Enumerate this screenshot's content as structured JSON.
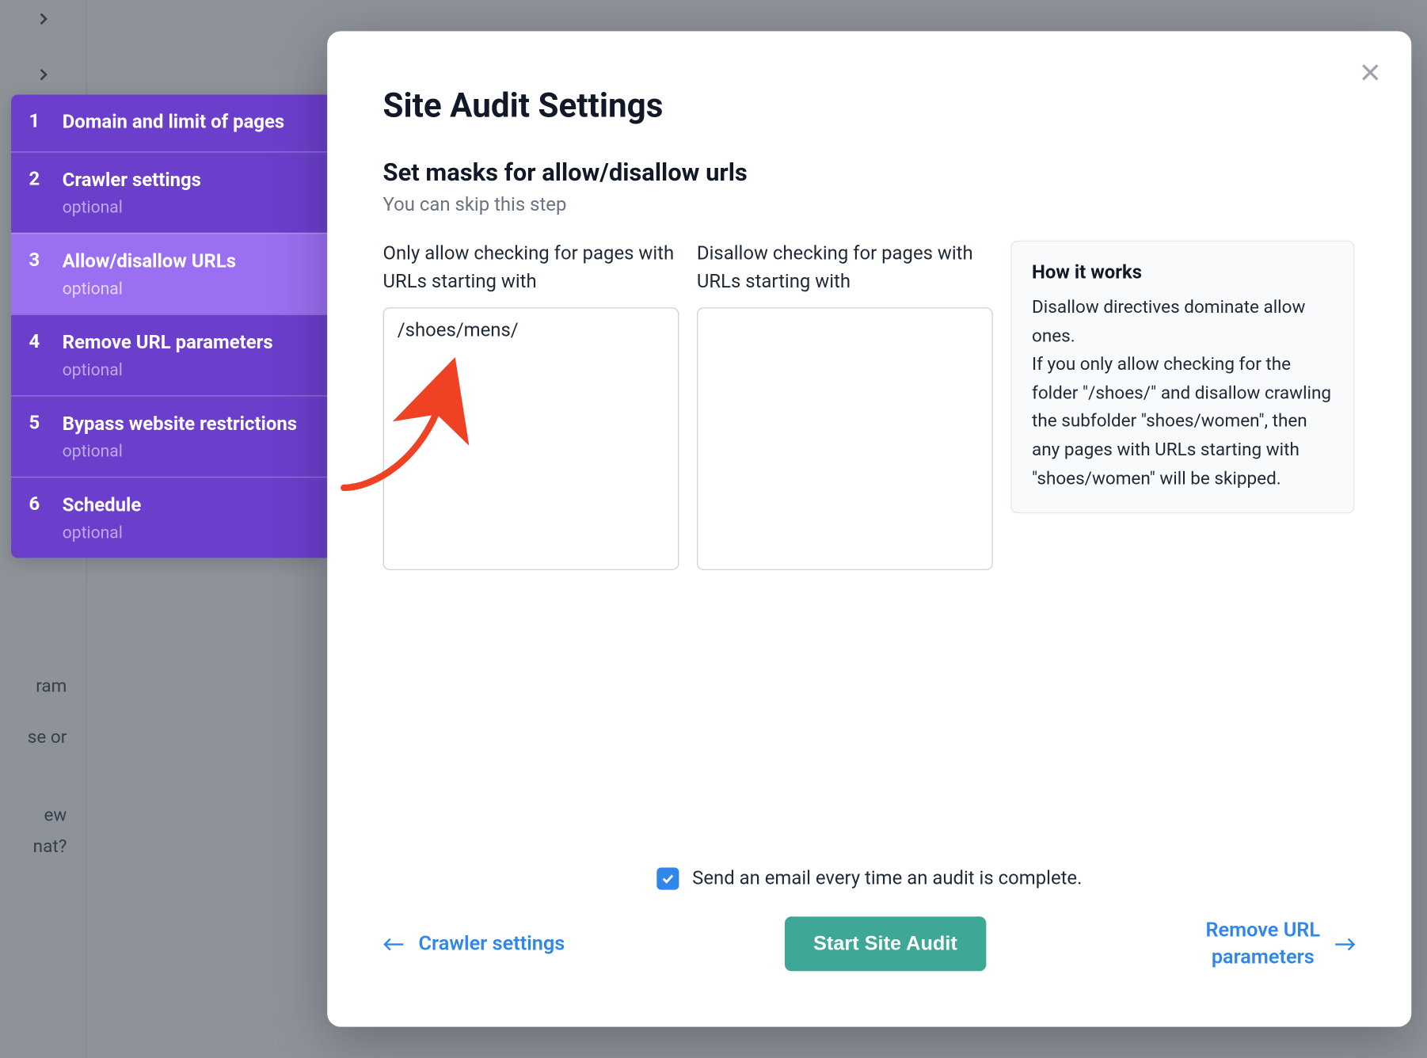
{
  "bg_fragments": [
    "ram",
    "se or",
    "ew",
    "nat?"
  ],
  "sidebar": {
    "steps": [
      {
        "num": "1",
        "title": "Domain and limit of pages",
        "sub": ""
      },
      {
        "num": "2",
        "title": "Crawler settings",
        "sub": "optional"
      },
      {
        "num": "3",
        "title": "Allow/disallow URLs",
        "sub": "optional"
      },
      {
        "num": "4",
        "title": "Remove URL parameters",
        "sub": "optional"
      },
      {
        "num": "5",
        "title": "Bypass website restrictions",
        "sub": "optional"
      },
      {
        "num": "6",
        "title": "Schedule",
        "sub": "optional"
      }
    ]
  },
  "modal": {
    "title": "Site Audit Settings",
    "heading": "Set masks for allow/disallow urls",
    "skip": "You can skip this step",
    "allow_label": "Only allow checking for pages with URLs starting with",
    "disallow_label": "Disallow checking for pages with URLs starting with",
    "allow_value": "/shoes/mens/",
    "disallow_value": "",
    "info_title": "How it works",
    "info_p1": "Disallow directives dominate allow ones.",
    "info_p2": "If you only allow checking for the folder \"/shoes/\" and disallow crawling the subfolder \"shoes/women\", then any pages with URLs starting with \"shoes/women\" will be skipped.",
    "checkbox_label": "Send an email every time an audit is complete.",
    "prev_label": "Crawler settings",
    "start_label": "Start Site Audit",
    "next_label_l1": "Remove URL",
    "next_label_l2": "parameters"
  }
}
